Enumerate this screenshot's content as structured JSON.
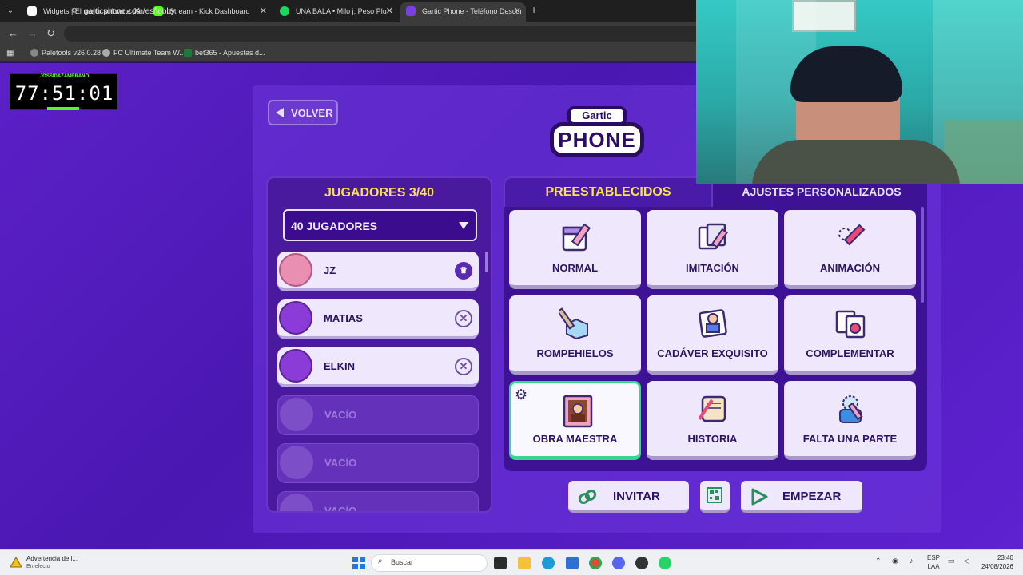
{
  "browser": {
    "tabs": [
      {
        "label": "Widgets | El mejor software pa",
        "active": false
      },
      {
        "label": "Stream - Kick Dashboard",
        "active": false
      },
      {
        "label": "UNA BALA • Milo j, Peso Plu",
        "active": false
      },
      {
        "label": "Gartic Phone - Teléfono Descon",
        "active": true
      }
    ],
    "url": "garticphone.com/es/lobby",
    "bookmarks": [
      {
        "label": "Paletools v26.0.28"
      },
      {
        "label": "FC Ultimate Team W..."
      },
      {
        "label": "bet365 - Apuestas d..."
      }
    ]
  },
  "timer": {
    "streamer": "JOSSIDAZAMBRANO",
    "value": "77:51:01",
    "source": "KICK"
  },
  "lobby": {
    "back_label": "VOLVER",
    "logo_top": "Gartic",
    "logo_bottom": "PHONE",
    "players_title": "JUGADORES 3/40",
    "player_limit": "40 JUGADORES",
    "players": [
      {
        "name": "JZ",
        "action": "♛",
        "empty": false
      },
      {
        "name": "MATIAS",
        "action": "✕",
        "empty": false
      },
      {
        "name": "ELKIN",
        "action": "✕",
        "empty": false
      },
      {
        "name": "VACÍO",
        "action": "",
        "empty": true
      },
      {
        "name": "VACÍO",
        "action": "",
        "empty": true
      },
      {
        "name": "VACÍO",
        "action": "",
        "empty": true
      }
    ],
    "tabs": {
      "presets": "PREESTABLECIDOS",
      "custom": "AJUSTES PERSONALIZADOS"
    },
    "modes": [
      {
        "label": "NORMAL",
        "icon": "calendar-pencil-icon",
        "selected": false
      },
      {
        "label": "IMITACIÓN",
        "icon": "copy-cards-icon",
        "selected": false
      },
      {
        "label": "ANIMACIÓN",
        "icon": "animation-pencil-icon",
        "selected": false
      },
      {
        "label": "ROMPEHIELOS",
        "icon": "ice-hammer-icon",
        "selected": false
      },
      {
        "label": "CADÁVER EXQUISITO",
        "icon": "body-picture-icon",
        "selected": false
      },
      {
        "label": "COMPLEMENTAR",
        "icon": "puzzle-cards-icon",
        "selected": false
      },
      {
        "label": "OBRA MAESTRA",
        "icon": "portrait-icon",
        "selected": true
      },
      {
        "label": "HISTORIA",
        "icon": "scroll-quill-icon",
        "selected": false
      },
      {
        "label": "FALTA UNA PARTE",
        "icon": "missing-part-icon",
        "selected": false
      }
    ],
    "invite_label": "INVITAR",
    "start_label": "EMPEZAR"
  },
  "taskbar": {
    "notification_title": "Advertencia de l...",
    "notification_sub": "En efecto",
    "search_placeholder": "Buscar",
    "lang": "ESP",
    "lang_sub": "LAA",
    "time": "23:40",
    "date": "24/08/2026"
  },
  "colors": {
    "page_bg": "#5c20c7",
    "title_yellow": "#f9e34a",
    "selected_green": "#3cd68a",
    "card_bg": "#efe7fc"
  }
}
